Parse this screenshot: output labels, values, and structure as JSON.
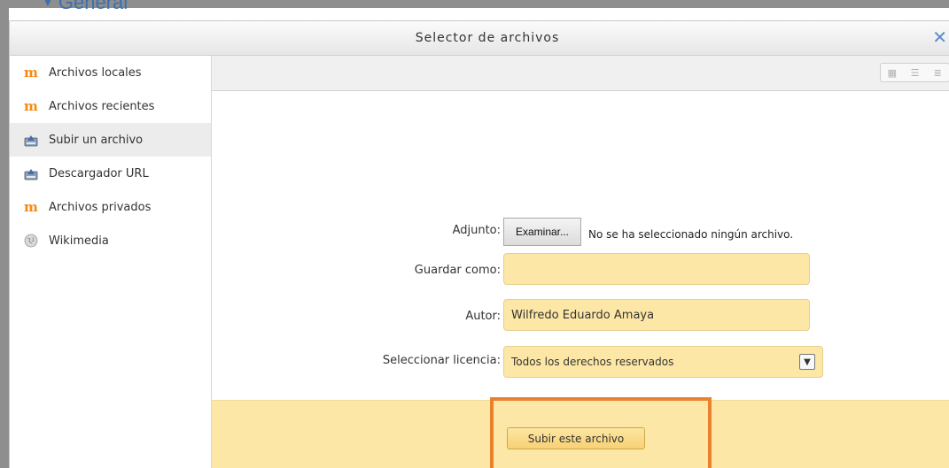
{
  "background": {
    "heading": "General"
  },
  "dialog": {
    "title": "Selector de archivos"
  },
  "sidebar": {
    "items": [
      {
        "label": "Archivos locales",
        "icon": "moodle-icon"
      },
      {
        "label": "Archivos recientes",
        "icon": "moodle-icon"
      },
      {
        "label": "Subir un archivo",
        "icon": "upload-icon",
        "active": true
      },
      {
        "label": "Descargador URL",
        "icon": "upload-icon"
      },
      {
        "label": "Archivos privados",
        "icon": "moodle-icon"
      },
      {
        "label": "Wikimedia",
        "icon": "wikimedia-icon"
      }
    ]
  },
  "form": {
    "attachment_label": "Adjunto:",
    "browse_label": "Examinar...",
    "no_file_text": "No se ha seleccionado ningún archivo.",
    "save_as_label": "Guardar como:",
    "save_as_value": "",
    "author_label": "Autor:",
    "author_value": "Wilfredo Eduardo Amaya",
    "license_label": "Seleccionar licencia:",
    "license_value": "Todos los derechos reservados"
  },
  "footer": {
    "submit_label": "Subir este archivo"
  },
  "colors": {
    "field_bg": "#fde7a6",
    "highlight": "#e9822f",
    "accent": "#5b8ec8"
  }
}
